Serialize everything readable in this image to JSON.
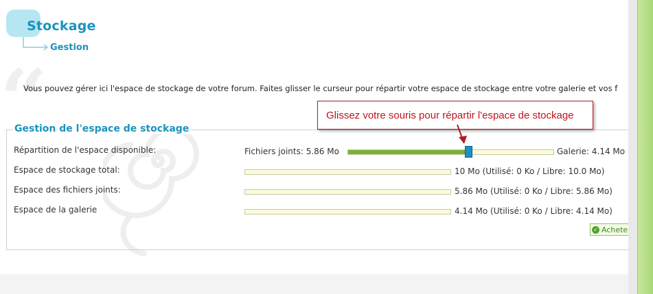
{
  "header": {
    "title": "Stockage",
    "subtitle": "Gestion"
  },
  "intro_text": "Vous pouvez gérer ici l'espace de stockage de votre forum. Faites glisser le curseur pour répartir votre espace de stockage entre votre galerie et vos f",
  "panel": {
    "title": "Gestion de l'espace de stockage",
    "rows": [
      {
        "label": "Répartition de l'espace disponible:",
        "left_value": "Fichiers joints: 5.86 Mo",
        "right_value": "Galerie: 4.14 Mo",
        "fill_fraction": 0.586
      },
      {
        "label": "Espace de stockage total:",
        "value": "10 Mo (Utilisé: 0 Ko / Libre: 10.0 Mo)",
        "used_fraction": 0
      },
      {
        "label": "Espace des fichiers joints:",
        "value": "5.86 Mo (Utilisé: 0 Ko / Libre: 5.86 Mo)",
        "used_fraction": 0
      },
      {
        "label": "Espace de la galerie",
        "value": "4.14 Mo (Utilisé: 0 Ko / Libre: 4.14 Mo)",
        "used_fraction": 0
      }
    ],
    "buy_label": "Acheter"
  },
  "tooltip": {
    "text": "Glissez votre souris pour répartir l'espace de stockage"
  },
  "colors": {
    "accent": "#1b93bd",
    "slider_fill": "#7bb13a",
    "slider_handle": "#1e8fc8",
    "tooltip_text": "#c0141c"
  },
  "icons": {
    "buy": "check-circle-icon"
  }
}
